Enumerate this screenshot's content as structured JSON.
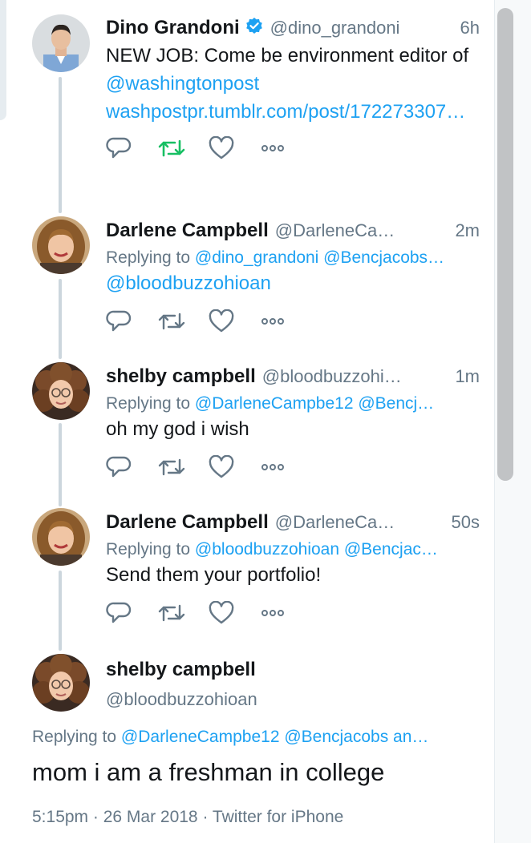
{
  "thread": [
    {
      "name": "Dino Grandoni",
      "verified": true,
      "handle": "@dino_grandoni",
      "time": "6h",
      "body_plain": "NEW JOB: Come be environment editor of ",
      "body_link": "@washingtonpost",
      "body_url": "washpostpr.tumblr.com/post/172273307…",
      "retweeted": true,
      "avatar_icon": "avatar-man-icon"
    },
    {
      "name": "Darlene Campbell",
      "handle": "@DarleneCa…",
      "time": "2m",
      "replying_prefix": "Replying to ",
      "replying_to": "@dino_grandoni @Bencjacobs…",
      "body_link": "@bloodbuzzohioan",
      "avatar_icon": "avatar-woman-short-hair-icon"
    },
    {
      "name": "shelby campbell",
      "handle": "@bloodbuzzohi…",
      "time": "1m",
      "replying_prefix": "Replying to ",
      "replying_to": "@DarleneCampbe12 @Bencj…",
      "body": "oh my god i wish",
      "avatar_icon": "avatar-woman-curly-hair-icon"
    },
    {
      "name": "Darlene Campbell",
      "handle": "@DarleneCa…",
      "time": "50s",
      "replying_prefix": "Replying to ",
      "replying_to": "@bloodbuzzohioan @Bencjac…",
      "body": "Send them your portfolio!",
      "avatar_icon": "avatar-woman-short-hair-icon"
    }
  ],
  "main": {
    "name": "shelby campbell",
    "handle": "@bloodbuzzohioan",
    "replying_prefix": "Replying to ",
    "replying_to": "@DarleneCampbe12 @Bencjacobs an…",
    "text": "mom i am a freshman in college",
    "meta": "5:15pm · 26 Mar 2018 · Twitter for iPhone",
    "avatar_icon": "avatar-woman-curly-hair-icon"
  },
  "colors": {
    "link": "#1da1f2",
    "secondary_text": "#657786",
    "retweet_active": "#17bf63",
    "verified": "#1da1f2",
    "thread_line": "#ccd6dd"
  },
  "icons": {
    "reply": "reply-icon",
    "retweet": "retweet-icon",
    "like": "heart-icon",
    "more": "more-dots-icon",
    "verified": "verified-badge-icon"
  }
}
